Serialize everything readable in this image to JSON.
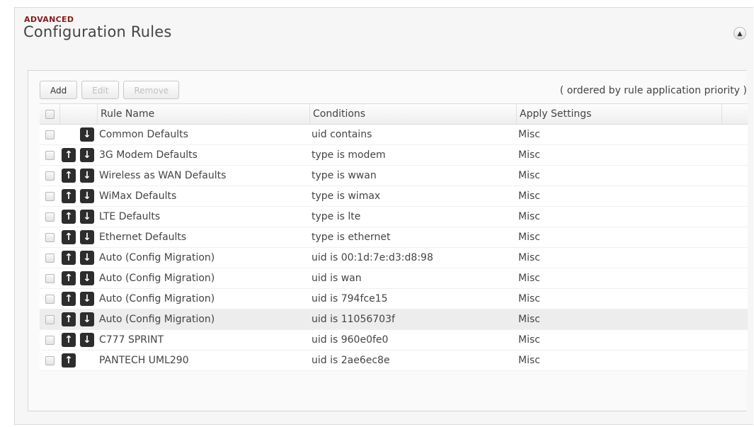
{
  "header": {
    "section_label": "ADVANCED",
    "title": "Configuration Rules",
    "collapse_icon": "chevron-up-icon"
  },
  "toolbar": {
    "add_label": "Add",
    "edit_label": "Edit",
    "remove_label": "Remove",
    "order_note": "( ordered by rule application priority )"
  },
  "table": {
    "columns": [
      "Rule Name",
      "Conditions",
      "Apply Settings"
    ],
    "rows": [
      {
        "name": "Common Defaults",
        "conditions": "uid contains",
        "apply": "Misc",
        "up": false,
        "down": true
      },
      {
        "name": "3G Modem Defaults",
        "conditions": "type is modem",
        "apply": "Misc",
        "up": true,
        "down": true
      },
      {
        "name": "Wireless as WAN Defaults",
        "conditions": "type is wwan",
        "apply": "Misc",
        "up": true,
        "down": true
      },
      {
        "name": "WiMax Defaults",
        "conditions": "type is wimax",
        "apply": "Misc",
        "up": true,
        "down": true
      },
      {
        "name": "LTE Defaults",
        "conditions": "type is lte",
        "apply": "Misc",
        "up": true,
        "down": true
      },
      {
        "name": "Ethernet Defaults",
        "conditions": "type is ethernet",
        "apply": "Misc",
        "up": true,
        "down": true
      },
      {
        "name": "Auto (Config Migration)",
        "conditions": "uid is 00:1d:7e:d3:d8:98",
        "apply": "Misc",
        "up": true,
        "down": true
      },
      {
        "name": "Auto (Config Migration)",
        "conditions": "uid is wan",
        "apply": "Misc",
        "up": true,
        "down": true
      },
      {
        "name": "Auto (Config Migration)",
        "conditions": "uid is 794fce15",
        "apply": "Misc",
        "up": true,
        "down": true
      },
      {
        "name": "Auto (Config Migration)",
        "conditions": "uid is 11056703f",
        "apply": "Misc",
        "up": true,
        "down": true,
        "highlighted": true
      },
      {
        "name": "C777 SPRINT",
        "conditions": "uid is 960e0fe0",
        "apply": "Misc",
        "up": true,
        "down": true
      },
      {
        "name": "PANTECH UML290",
        "conditions": "uid is 2ae6ec8e",
        "apply": "Misc",
        "up": true,
        "down": false
      }
    ]
  },
  "icons": {
    "up": "arrow-up-icon",
    "down": "arrow-down-icon"
  },
  "colors": {
    "section_label": "#8a1b1b",
    "arrow_bg": "#2d2d2d",
    "row_highlight": "#ededed"
  }
}
